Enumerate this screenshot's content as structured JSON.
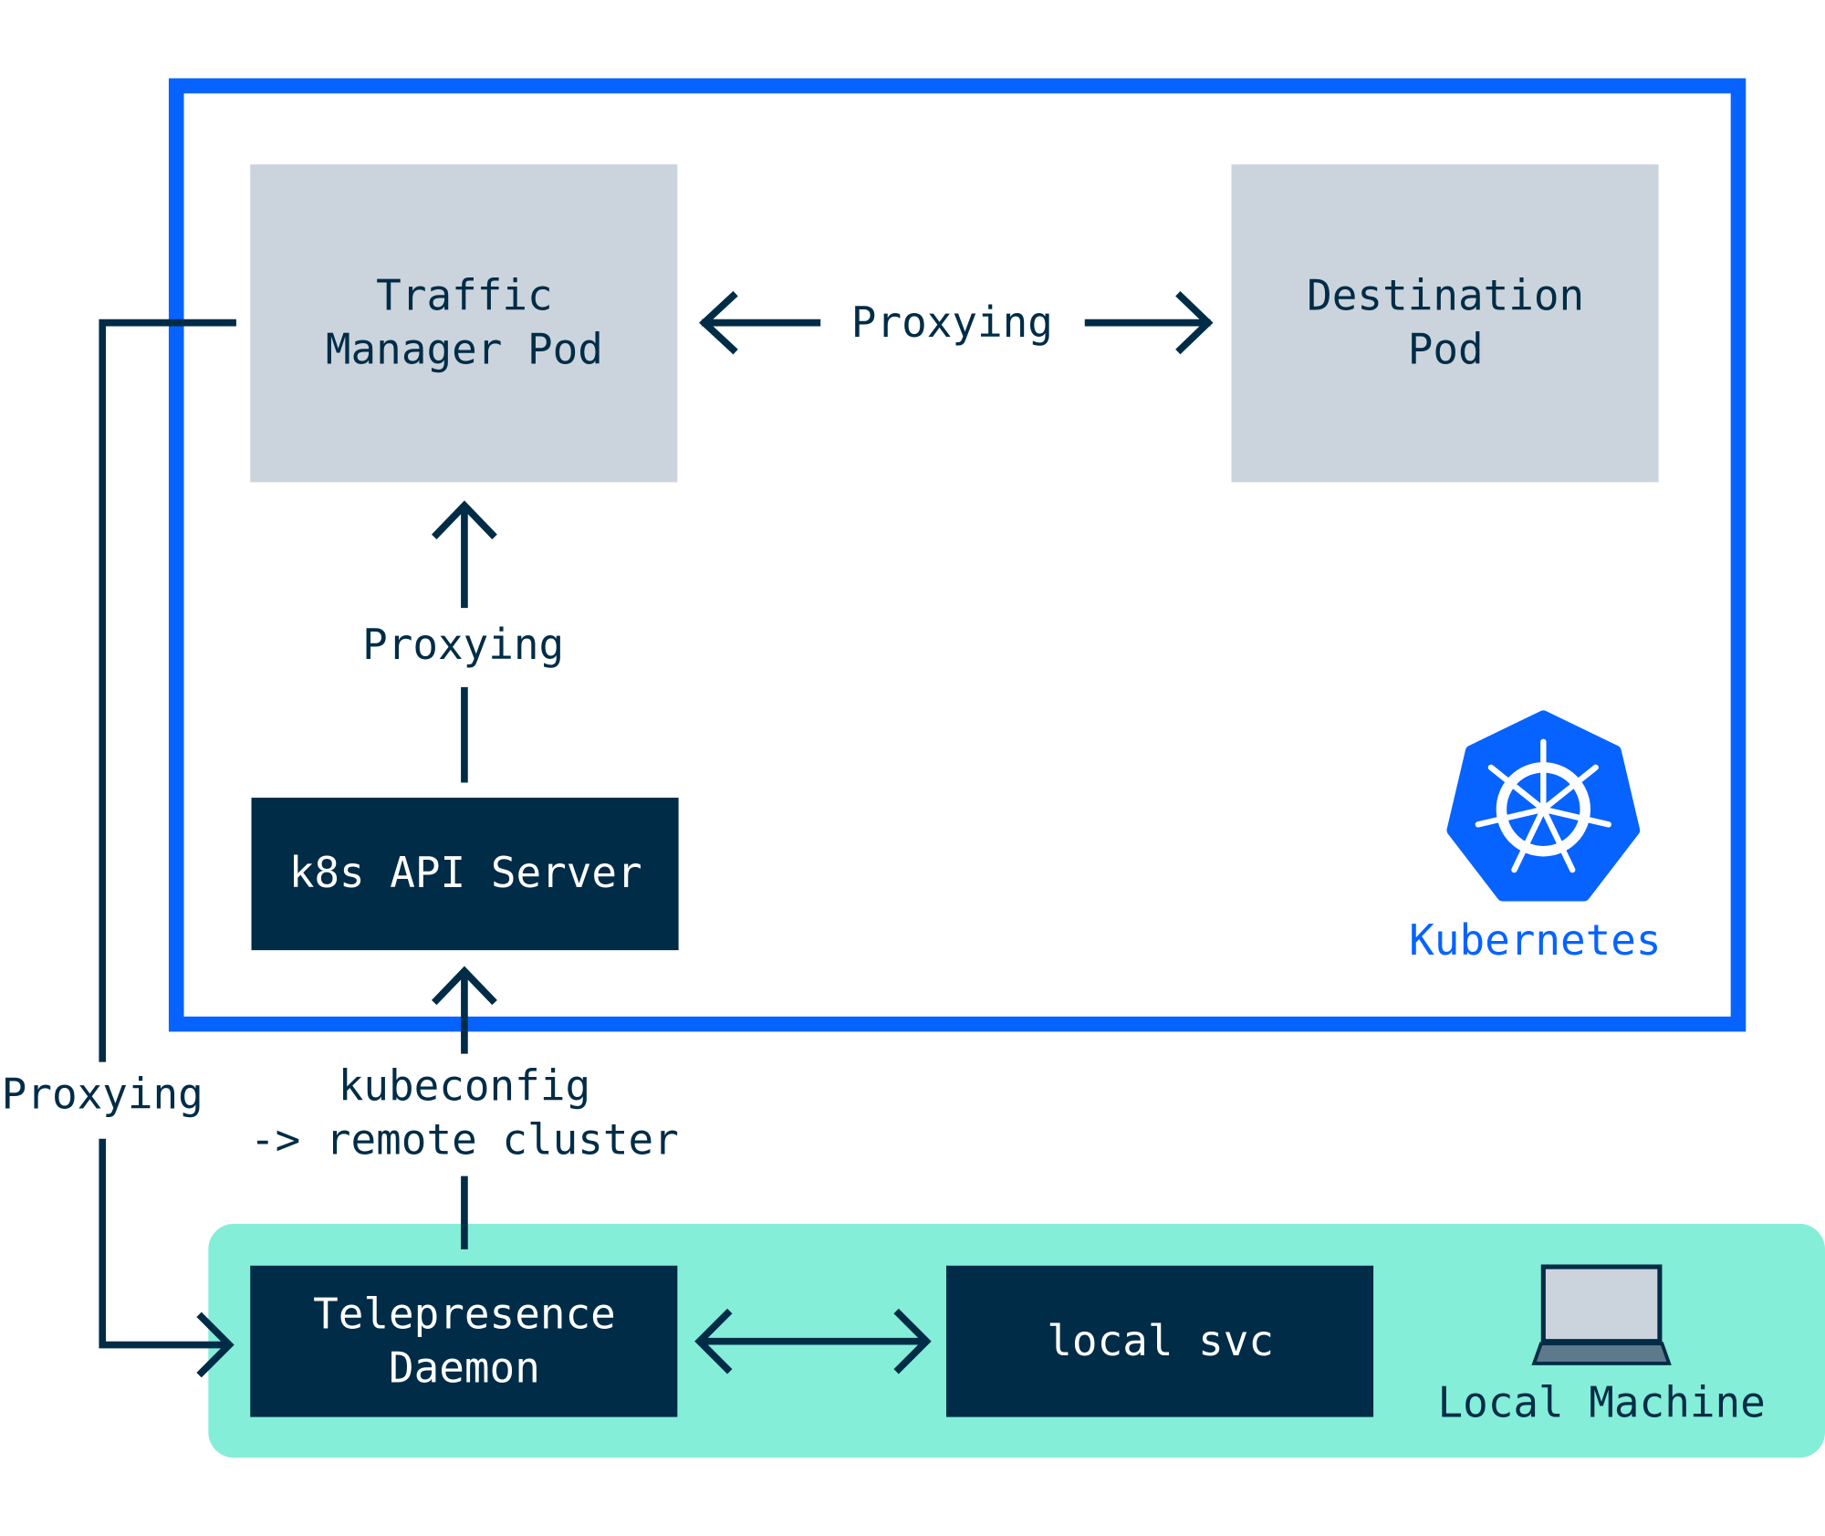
{
  "colors": {
    "cluster_border": "#0763ff",
    "pod_fill": "#cbd4dc",
    "dark_box": "#002c47",
    "local_bg": "#84eed8",
    "text_dark": "#002c47",
    "text_light": "#ffffff",
    "kubernetes_blue": "#0763ff"
  },
  "cluster": {
    "label": "Kubernetes",
    "logo_icon": "kubernetes-helm-icon",
    "traffic_manager": {
      "line1": "Traffic",
      "line2": "Manager Pod"
    },
    "destination": {
      "line1": "Destination",
      "line2": "Pod"
    },
    "api_server": "k8s API Server",
    "pod_link_label": "Proxying",
    "api_link_label": "Proxying"
  },
  "local": {
    "label": "Local Machine",
    "laptop_icon": "laptop-icon",
    "daemon": {
      "line1": "Telepresence",
      "line2": "Daemon"
    },
    "local_svc": "local svc"
  },
  "links": {
    "left_proxy_label": "Proxying",
    "kubeconfig": {
      "line1": "kubeconfig",
      "line2": "-> remote cluster"
    }
  }
}
